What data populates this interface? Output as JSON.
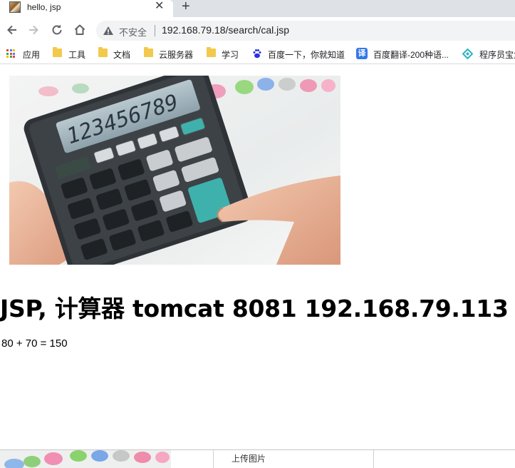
{
  "tab": {
    "title": "hello, jsp",
    "close_glyph": "✕",
    "new_tab_glyph": "+"
  },
  "address_bar": {
    "security_label": "不安全",
    "url": "192.168.79.18/search/cal.jsp"
  },
  "bookmarks": [
    {
      "label": "应用",
      "icon": "apps-grid-icon"
    },
    {
      "label": "工具",
      "icon": "folder-icon"
    },
    {
      "label": "文档",
      "icon": "folder-icon"
    },
    {
      "label": "云服务器",
      "icon": "folder-icon"
    },
    {
      "label": "学习",
      "icon": "folder-icon"
    },
    {
      "label": "百度一下，你就知道",
      "icon": "baidu-paw-icon"
    },
    {
      "label": "百度翻译-200种语...",
      "icon": "translate-icon"
    },
    {
      "label": "程序员宝盒",
      "icon": "diamond-icon"
    }
  ],
  "translate_badge": "译",
  "page": {
    "heading": "JSP, 计算器 tomcat 8081 192.168.79.113",
    "result": "80 + 70 = 150",
    "calculator_display": "123456789"
  },
  "bottom_bar": {
    "upload_label": "上传图片"
  }
}
